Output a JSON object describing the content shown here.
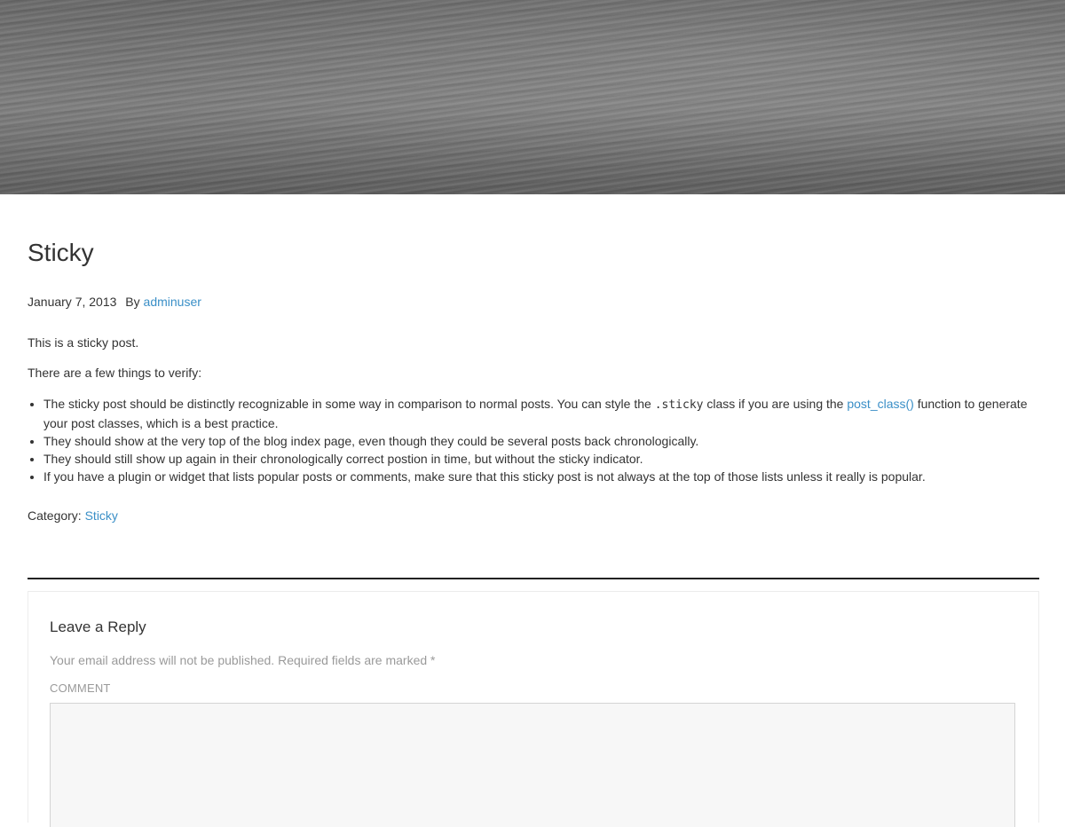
{
  "post": {
    "title": "Sticky",
    "date": "January 7, 2013",
    "by_label": "By",
    "author": "adminuser",
    "intro": "This is a sticky post.",
    "lead": "There are a few things to verify:",
    "items": [
      {
        "before": "The sticky post should be distinctly recognizable in some way in comparison to normal posts. You can style the ",
        "code": ".sticky",
        "middle": " class if you are using the ",
        "link": "post_class()",
        "after": " function to generate your post classes, which is a best practice."
      },
      {
        "text": "They should show at the very top of the blog index page, even though they could be several posts back chronologically."
      },
      {
        "text": "They should still show up again in their chronologically correct postion in time, but without the sticky indicator."
      },
      {
        "text": "If you have a plugin or widget that lists popular posts or comments, make sure that this sticky post is not always at the top of those lists unless it really is popular."
      }
    ],
    "category_label": "Category:",
    "category": "Sticky"
  },
  "reply": {
    "title": "Leave a Reply",
    "notes": "Your email address will not be published. Required fields are marked *",
    "comment_label": "COMMENT",
    "comment_value": ""
  },
  "colors": {
    "link": "#3a8fc7",
    "text": "#333333",
    "muted": "#9a9a9a"
  }
}
